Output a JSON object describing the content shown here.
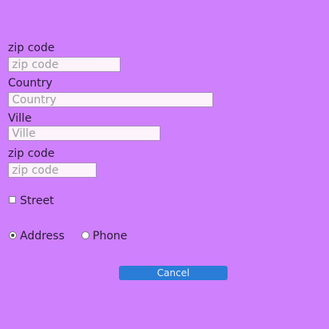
{
  "form": {
    "zip1": {
      "label": "zip code",
      "placeholder": "zip code",
      "value": ""
    },
    "country": {
      "label": "Country",
      "placeholder": "Country",
      "value": ""
    },
    "ville": {
      "label": "Ville",
      "placeholder": "Ville",
      "value": ""
    },
    "zip2": {
      "label": "zip code",
      "placeholder": "zip code",
      "value": ""
    },
    "street": {
      "label": "Street",
      "checked": false
    },
    "contact": {
      "options": [
        {
          "label": "Address",
          "selected": true
        },
        {
          "label": "Phone",
          "selected": false
        }
      ]
    },
    "cancel_label": "Cancel"
  },
  "colors": {
    "background": "#cf80fd",
    "button": "#2a7dd6"
  }
}
